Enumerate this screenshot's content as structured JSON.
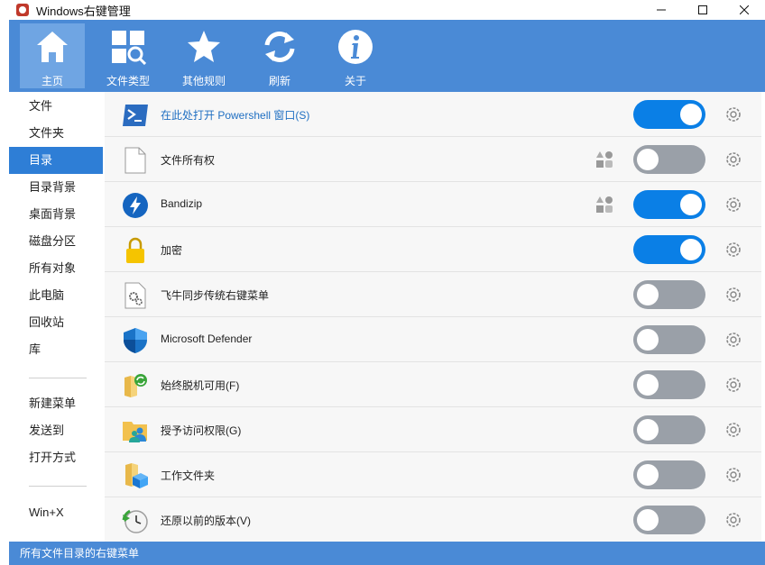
{
  "window": {
    "title": "Windows右键管理"
  },
  "toolbar": {
    "items": [
      {
        "label": "主页",
        "icon": "home-icon",
        "active": true
      },
      {
        "label": "文件类型",
        "icon": "file-types-icon",
        "active": false
      },
      {
        "label": "其他规则",
        "icon": "star-icon",
        "active": false
      },
      {
        "label": "刷新",
        "icon": "refresh-icon",
        "active": false
      },
      {
        "label": "关于",
        "icon": "info-icon",
        "active": false
      }
    ]
  },
  "sidebar": {
    "items": [
      {
        "label": "文件"
      },
      {
        "label": "文件夹"
      },
      {
        "label": "目录",
        "active": true
      },
      {
        "label": "目录背景"
      },
      {
        "label": "桌面背景"
      },
      {
        "label": "磁盘分区"
      },
      {
        "label": "所有对象"
      },
      {
        "label": "此电脑"
      },
      {
        "label": "回收站"
      },
      {
        "label": "库"
      },
      {
        "label": "新建菜单"
      },
      {
        "label": "发送到"
      },
      {
        "label": "打开方式"
      },
      {
        "label": "Win+X"
      }
    ]
  },
  "entries": [
    {
      "label": "在此处打开 Powershell 窗口(S)",
      "icon": "powershell-icon",
      "enabled": true,
      "highlighted": true,
      "ext": false
    },
    {
      "label": "文件所有权",
      "icon": "blank-file-icon",
      "enabled": false,
      "ext": true
    },
    {
      "label": "Bandizip",
      "icon": "bandizip-icon",
      "enabled": true,
      "ext": true
    },
    {
      "label": "加密",
      "icon": "lock-icon",
      "enabled": true,
      "ext": false
    },
    {
      "label": "飞牛同步传统右键菜单",
      "icon": "file-gear-icon",
      "enabled": false,
      "ext": false
    },
    {
      "label": "Microsoft Defender",
      "icon": "defender-shield-icon",
      "enabled": false,
      "ext": false
    },
    {
      "label": "始终脱机可用(F)",
      "icon": "offline-sync-icon",
      "enabled": false,
      "ext": false
    },
    {
      "label": "授予访问权限(G)",
      "icon": "share-folder-icon",
      "enabled": false,
      "ext": false
    },
    {
      "label": "工作文件夹",
      "icon": "work-folder-icon",
      "enabled": false,
      "ext": false
    },
    {
      "label": "还原以前的版本(V)",
      "icon": "restore-clock-icon",
      "enabled": false,
      "ext": false
    }
  ],
  "statusbar": {
    "text": "所有文件目录的右键菜单"
  },
  "colors": {
    "accent": "#4a8ad6",
    "toggle_on": "#0a7fe6",
    "toggle_off": "#9aa0a8",
    "selected": "#2e7ed6"
  }
}
